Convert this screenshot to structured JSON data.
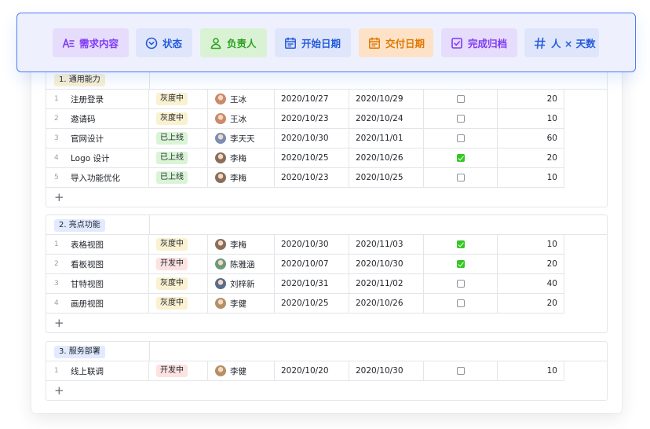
{
  "toolbar": {
    "fields": [
      {
        "label": "需求内容",
        "icon": "text-field-icon",
        "bg": "#e6dcfb",
        "color": "#7f3bf5"
      },
      {
        "label": "状态",
        "icon": "chevron-circle-icon",
        "bg": "#dfe6fb",
        "color": "#245bdb"
      },
      {
        "label": "负责人",
        "icon": "person-icon",
        "bg": "#d9f2d4",
        "color": "#2ea121"
      },
      {
        "label": "开始日期",
        "icon": "calendar-icon",
        "bg": "#dfe6fb",
        "color": "#245bdb"
      },
      {
        "label": "交付日期",
        "icon": "calendar-icon",
        "bg": "#fde2c8",
        "color": "#de7802"
      },
      {
        "label": "完成归档",
        "icon": "checkbox-icon",
        "bg": "#e6dcfb",
        "color": "#7f3bf5"
      },
      {
        "label": "人 × 天数",
        "icon": "number-icon",
        "bg": "#dfe6fb",
        "color": "#245bdb"
      }
    ]
  },
  "status_colors": {
    "灰度中": {
      "bg": "#faf1d1",
      "color": "#1f2329"
    },
    "已上线": {
      "bg": "#d9f5d6",
      "color": "#1f2329"
    },
    "开发中": {
      "bg": "#fde2e2",
      "color": "#1f2329"
    }
  },
  "avatar_colors": {
    "王冰": "#c98b6b",
    "李天天": "#7a8fb5",
    "李梅": "#8a6d5b",
    "陈雅涵": "#6a9a7a",
    "刘梓新": "#5b6b8a",
    "李健": "#b59065"
  },
  "groups": [
    {
      "title": "1. 通用能力",
      "tag_bg": "#faf1d1",
      "add": "+",
      "rows": [
        {
          "idx": "1",
          "name": "注册登录",
          "status": "灰度中",
          "owner": "王冰",
          "start": "2020/10/27",
          "end": "2020/10/29",
          "done": false,
          "days": "20"
        },
        {
          "idx": "2",
          "name": "邀请码",
          "status": "灰度中",
          "owner": "王冰",
          "start": "2020/10/23",
          "end": "2020/10/24",
          "done": false,
          "days": "10"
        },
        {
          "idx": "3",
          "name": "官网设计",
          "status": "已上线",
          "owner": "李天天",
          "start": "2020/10/30",
          "end": "2020/11/01",
          "done": false,
          "days": "60"
        },
        {
          "idx": "4",
          "name": "Logo 设计",
          "status": "已上线",
          "owner": "李梅",
          "start": "2020/10/25",
          "end": "2020/10/26",
          "done": true,
          "days": "20"
        },
        {
          "idx": "5",
          "name": "导入功能优化",
          "status": "已上线",
          "owner": "李梅",
          "start": "2020/10/23",
          "end": "2020/10/25",
          "done": false,
          "days": "10"
        }
      ]
    },
    {
      "title": "2. 亮点功能",
      "tag_bg": "#e1eaff",
      "add": "+",
      "rows": [
        {
          "idx": "1",
          "name": "表格视图",
          "status": "灰度中",
          "owner": "李梅",
          "start": "2020/10/30",
          "end": "2020/11/03",
          "done": true,
          "days": "10"
        },
        {
          "idx": "2",
          "name": "看板视图",
          "status": "开发中",
          "owner": "陈雅涵",
          "start": "2020/10/07",
          "end": "2020/10/30",
          "done": true,
          "days": "20"
        },
        {
          "idx": "3",
          "name": "甘特视图",
          "status": "灰度中",
          "owner": "刘梓新",
          "start": "2020/10/31",
          "end": "2020/11/02",
          "done": false,
          "days": "40"
        },
        {
          "idx": "4",
          "name": "画册视图",
          "status": "灰度中",
          "owner": "李健",
          "start": "2020/10/25",
          "end": "2020/10/26",
          "done": false,
          "days": "20"
        }
      ]
    },
    {
      "title": "3. 服务部署",
      "tag_bg": "#e1eaff",
      "add": "+",
      "rows": [
        {
          "idx": "1",
          "name": "线上联调",
          "status": "开发中",
          "owner": "李健",
          "start": "2020/10/20",
          "end": "2020/10/30",
          "done": false,
          "days": "10"
        }
      ]
    }
  ]
}
